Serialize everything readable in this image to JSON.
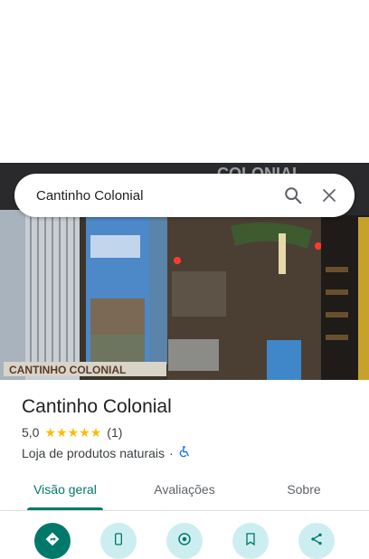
{
  "search": {
    "query": "Cantinho Colonial"
  },
  "photo": {
    "sign_text": "CANTINHO COLONIAL",
    "top_sign": "COLONIAL"
  },
  "place": {
    "name": "Cantinho Colonial",
    "rating": "5,0",
    "stars": 5,
    "review_count": "(1)",
    "category": "Loja de produtos naturais",
    "separator": "·"
  },
  "tabs": [
    {
      "label": "Visão geral",
      "active": true
    },
    {
      "label": "Avaliações",
      "active": false
    },
    {
      "label": "Sobre",
      "active": false
    }
  ],
  "actions": [
    {
      "icon": "directions-icon"
    },
    {
      "icon": "phone-icon"
    },
    {
      "icon": "explore-icon"
    },
    {
      "icon": "save-icon"
    },
    {
      "icon": "share-icon"
    }
  ],
  "colors": {
    "accent": "#00796b",
    "star": "#fbbc04",
    "action_bg": "#cdeef0"
  }
}
